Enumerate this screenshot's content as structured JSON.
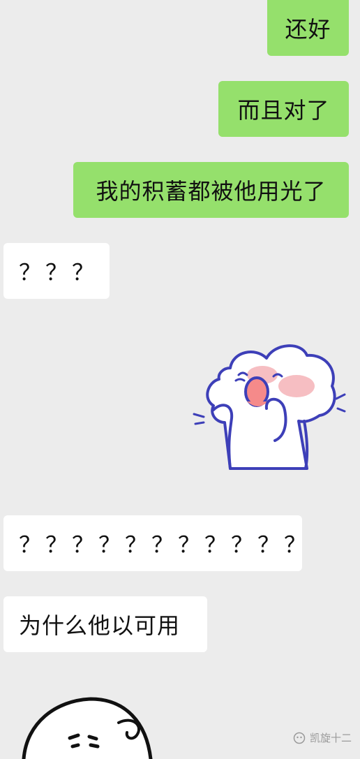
{
  "messages": [
    {
      "side": "sent",
      "text": "还好"
    },
    {
      "side": "sent",
      "text": "而且对了"
    },
    {
      "side": "sent",
      "text": "我的积蓄都被他用光了"
    },
    {
      "side": "received",
      "text": "？？？"
    },
    {
      "side": "received",
      "text": "？？？？？？？？？？？"
    },
    {
      "side": "received",
      "text": "为什么他以可用"
    }
  ],
  "stickers": [
    {
      "name": "crying-blob-sticker"
    },
    {
      "name": "grumpy-face-sticker"
    }
  ],
  "watermark": {
    "text": "凯旋十二",
    "icon": "wechat-account-icon"
  },
  "colors": {
    "background": "#ececec",
    "sent_bubble": "#95e06c",
    "received_bubble": "#ffffff",
    "sticker_line": "#3d3fb8",
    "blush": "#f2a3a8"
  }
}
